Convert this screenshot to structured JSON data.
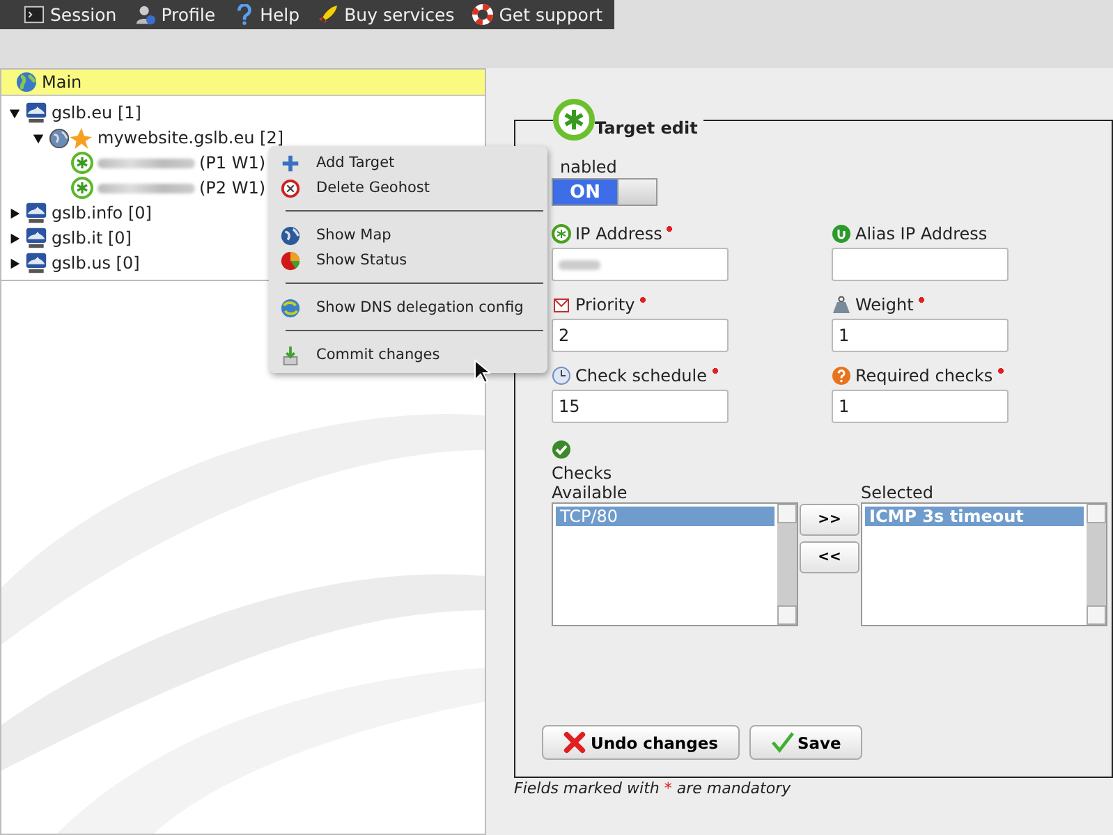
{
  "menubar": [
    {
      "label": "Session"
    },
    {
      "label": "Profile"
    },
    {
      "label": "Help"
    },
    {
      "label": "Buy services"
    },
    {
      "label": "Get support"
    }
  ],
  "tree": {
    "header": "Main",
    "nodes": [
      {
        "label": "gslb.eu [1]",
        "kind": "domain",
        "expanded": true,
        "children": [
          {
            "label": "mywebsite.gslb.eu [2]",
            "kind": "geohost",
            "expanded": true,
            "children": [
              {
                "label": "(P1 W1)",
                "kind": "target"
              },
              {
                "label": "(P2 W1)",
                "kind": "target"
              }
            ]
          }
        ]
      },
      {
        "label": "gslb.info [0]",
        "kind": "domain",
        "expanded": false
      },
      {
        "label": "gslb.it [0]",
        "kind": "domain",
        "expanded": false
      },
      {
        "label": "gslb.us [0]",
        "kind": "domain",
        "expanded": false
      }
    ]
  },
  "context_menu": [
    [
      {
        "label": "Add Target"
      },
      {
        "label": "Delete Geohost"
      }
    ],
    [
      {
        "label": "Show Map"
      },
      {
        "label": "Show Status"
      }
    ],
    [
      {
        "label": "Show DNS delegation config"
      }
    ],
    [
      {
        "label": "Commit changes"
      }
    ]
  ],
  "form": {
    "title": "Target edit",
    "enabled": {
      "label": "nabled",
      "on": true,
      "on_text": "ON"
    },
    "fields": [
      {
        "label": "IP Address",
        "required": true,
        "redacted": true
      },
      {
        "label": "Alias IP Address",
        "required": false
      },
      {
        "label": "Priority",
        "required": true,
        "value": "2"
      },
      {
        "label": "Weight",
        "required": true,
        "value": "1"
      },
      {
        "label": "Check schedule",
        "required": true,
        "value": "15"
      },
      {
        "label": "Required checks",
        "required": true,
        "value": "1"
      }
    ],
    "checks": {
      "label": "Checks",
      "available": {
        "label": "Available",
        "options": [
          {
            "label": "TCP/80",
            "selected": true
          }
        ]
      },
      "chosen": {
        "label": "Selected",
        "options": [
          {
            "label": "ICMP 3s timeout",
            "selected": true
          }
        ]
      },
      "add_button": ">>",
      "remove_button": "<<"
    },
    "buttons": [
      {
        "label": "Undo changes"
      },
      {
        "label": "Save"
      }
    ],
    "footnote": {
      "before": "Fields marked with",
      "mark": "*",
      "after": "are mandatory"
    }
  }
}
